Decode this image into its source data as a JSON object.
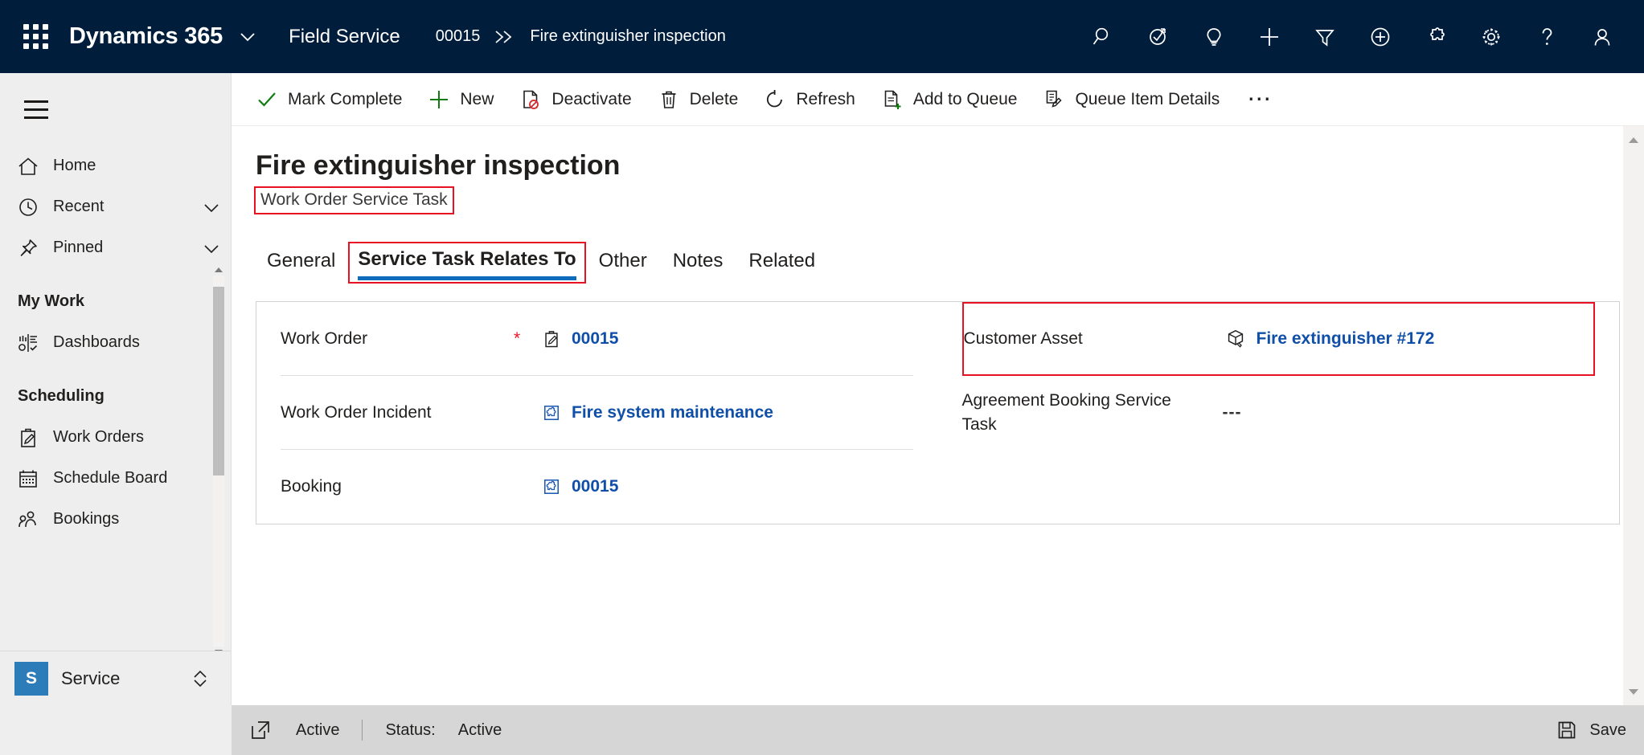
{
  "topbar": {
    "waffle_icon": "waffle-grid-icon",
    "brand": "Dynamics 365",
    "brand_chevron_icon": "chevron-down-icon",
    "app_name": "Field Service",
    "breadcrumb": {
      "record_id": "00015",
      "separator": "≫",
      "current": "Fire extinguisher inspection"
    },
    "icons": [
      {
        "name": "search-icon",
        "title": "Search"
      },
      {
        "name": "diagnostics-icon",
        "title": "Diagnostics"
      },
      {
        "name": "lightbulb-icon",
        "title": "Insights"
      },
      {
        "name": "quick-create-plus-icon",
        "title": "Quick create"
      },
      {
        "name": "filter-icon",
        "title": "Filter"
      },
      {
        "name": "add-circle-icon",
        "title": "Add"
      },
      {
        "name": "puzzle-icon",
        "title": "Extensions"
      },
      {
        "name": "settings-gear-icon",
        "title": "Settings"
      },
      {
        "name": "help-question-icon",
        "title": "Help"
      },
      {
        "name": "user-avatar-icon",
        "title": "Account"
      }
    ]
  },
  "sidebar": {
    "hamburger_icon": "hamburger-menu-icon",
    "items": [
      {
        "label": "Home",
        "icon": "home-icon",
        "chevron": false
      },
      {
        "label": "Recent",
        "icon": "clock-icon",
        "chevron": true
      },
      {
        "label": "Pinned",
        "icon": "pin-icon",
        "chevron": true
      }
    ],
    "groups": [
      {
        "title": "My Work",
        "items": [
          {
            "label": "Dashboards",
            "icon": "dashboard-chart-icon"
          }
        ]
      },
      {
        "title": "Scheduling",
        "items": [
          {
            "label": "Work Orders",
            "icon": "clipboard-pencil-icon"
          },
          {
            "label": "Schedule Board",
            "icon": "calendar-icon"
          },
          {
            "label": "Bookings",
            "icon": "people-icon"
          }
        ]
      }
    ],
    "area_switcher": {
      "badge": "S",
      "label": "Service",
      "chevron_icon": "chevron-updown-icon"
    }
  },
  "commandbar": {
    "buttons": [
      {
        "label": "Mark Complete",
        "icon": "checkmark-icon",
        "accent": "#107c10"
      },
      {
        "label": "New",
        "icon": "plus-icon",
        "accent": "#107c10"
      },
      {
        "label": "Deactivate",
        "icon": "deactivate-page-icon",
        "accent": "#201f1e"
      },
      {
        "label": "Delete",
        "icon": "trash-icon",
        "accent": "#201f1e"
      },
      {
        "label": "Refresh",
        "icon": "refresh-icon",
        "accent": "#201f1e"
      },
      {
        "label": "Add to Queue",
        "icon": "add-to-queue-icon",
        "accent": "#201f1e"
      },
      {
        "label": "Queue Item Details",
        "icon": "queue-item-details-icon",
        "accent": "#201f1e"
      }
    ],
    "overflow_label": "⋯"
  },
  "record": {
    "title": "Fire extinguisher inspection",
    "entity_label": "Work Order Service Task"
  },
  "tabs": [
    {
      "label": "General",
      "active": false,
      "annotated": false
    },
    {
      "label": "Service Task Relates To",
      "active": true,
      "annotated": true
    },
    {
      "label": "Other",
      "active": false,
      "annotated": false
    },
    {
      "label": "Notes",
      "active": false,
      "annotated": false
    },
    {
      "label": "Related",
      "active": false,
      "annotated": false
    }
  ],
  "form": {
    "left_fields": [
      {
        "label": "Work Order",
        "required": "*",
        "icon": "clipboard-pencil-icon",
        "value": "00015",
        "is_link": true,
        "annotated": false
      },
      {
        "label": "Work Order Incident",
        "required": "",
        "icon": "incident-puzzle-icon",
        "value": "Fire system maintenance",
        "is_link": true,
        "annotated": false
      },
      {
        "label": "Booking",
        "required": "",
        "icon": "incident-puzzle-icon",
        "value": "00015",
        "is_link": true,
        "annotated": false
      }
    ],
    "right_fields": [
      {
        "label": "Customer Asset",
        "required": "",
        "icon": "asset-box-icon",
        "value": "Fire extinguisher #172",
        "is_link": true,
        "annotated": true
      },
      {
        "label": "Agreement Booking Service Task",
        "required": "",
        "icon": "",
        "value": "---",
        "is_link": false,
        "annotated": false
      }
    ]
  },
  "footer": {
    "popout_icon": "popout-icon",
    "state": "Active",
    "status_label": "Status:",
    "status_value": "Active",
    "save_label": "Save",
    "save_icon": "save-floppy-icon"
  },
  "colors": {
    "topbar_bg": "#001e3c",
    "accent_blue": "#0f6cbd",
    "link_blue": "#0f4fa8",
    "annotation_red": "#e81123",
    "green": "#107c10",
    "sidebar_bg": "#eeeeee",
    "footer_bg": "#d6d6d6"
  }
}
